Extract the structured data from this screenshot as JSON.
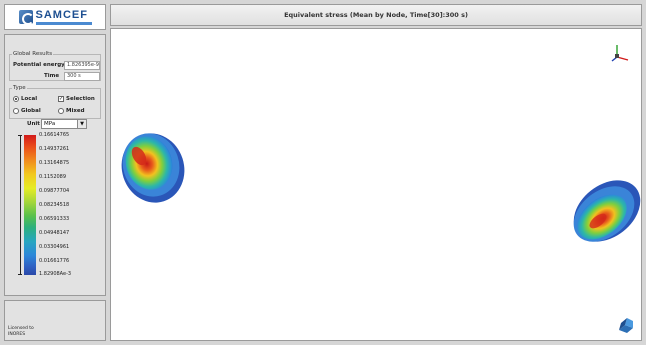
{
  "logo": {
    "text": "SAMCEF"
  },
  "header": {
    "title": "Equivalent stress (Mean by Node, Time[30]:300 s)"
  },
  "global_results": {
    "legend": "Global Results",
    "potential_energy_label": "Potential energy",
    "potential_energy_value": "1.826395e-9 J",
    "time_label": "Time",
    "time_value": "300 s"
  },
  "type": {
    "legend": "Type",
    "local": "Local",
    "global": "Global",
    "selection": "Selection",
    "mixed": "Mixed",
    "local_checked": true,
    "selection_checked": true
  },
  "unit": {
    "label": "Unit",
    "value": "MPa"
  },
  "color_legend": {
    "values": [
      "0.16614765",
      "0.14937261",
      "0.13164875",
      "0.1152089",
      "0.09877704",
      "0.08234518",
      "0.06591333",
      "0.04948147",
      "0.03304961",
      "0.01661776",
      "1.82908Ae-3"
    ]
  },
  "license": {
    "line1": "Licensed to",
    "line2": "INORES"
  },
  "colors": {
    "max": "#d21a1a",
    "mid": "#e6ec25",
    "min": "#2a48a8",
    "accent": "#1d4f91"
  }
}
